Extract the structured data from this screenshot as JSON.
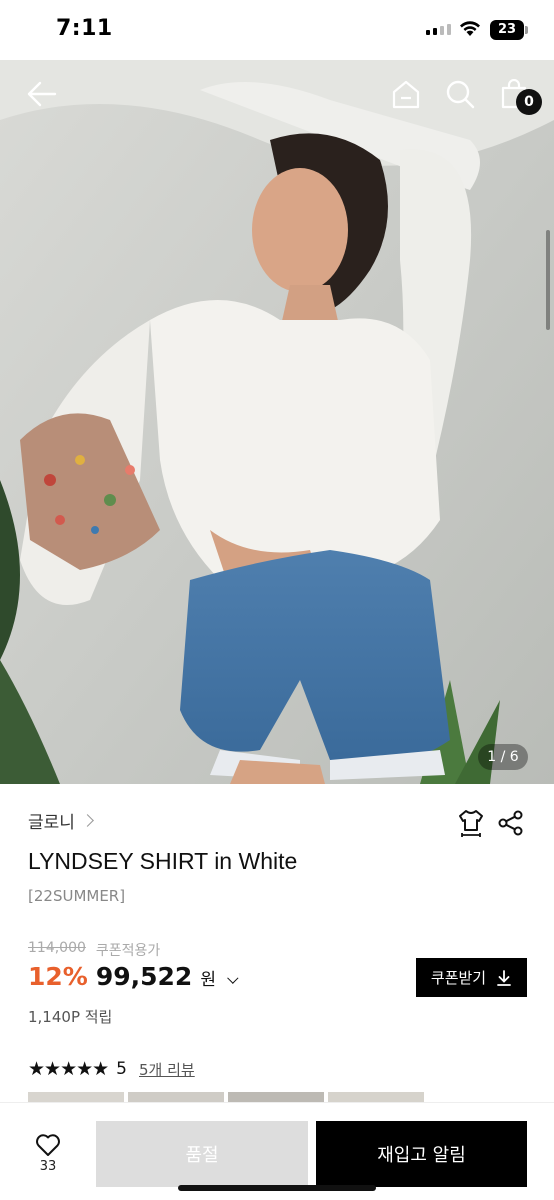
{
  "status_bar": {
    "time": "7:11",
    "battery": "23"
  },
  "header": {
    "cart_count": "0"
  },
  "gallery": {
    "page_indicator": "1 / 6"
  },
  "product": {
    "brand": "글로니",
    "title": "LYNDSEY SHIRT in White",
    "season": "[22SUMMER]",
    "original_price": "114,000",
    "coupon_price_label": "쿠폰적용가",
    "discount": "12%",
    "price": "99,522",
    "currency": "원",
    "points": "1,140P 적립",
    "coupon_button": "쿠폰받기",
    "rating_stars": "★★★★★",
    "rating": "5",
    "review_link": "5개 리뷰"
  },
  "bottom_bar": {
    "like_count": "33",
    "soldout_label": "품절",
    "restock_label": "재입고 알림"
  },
  "colors": {
    "accent": "#e8602c",
    "primary": "#000000",
    "disabled": "#dddddd"
  }
}
